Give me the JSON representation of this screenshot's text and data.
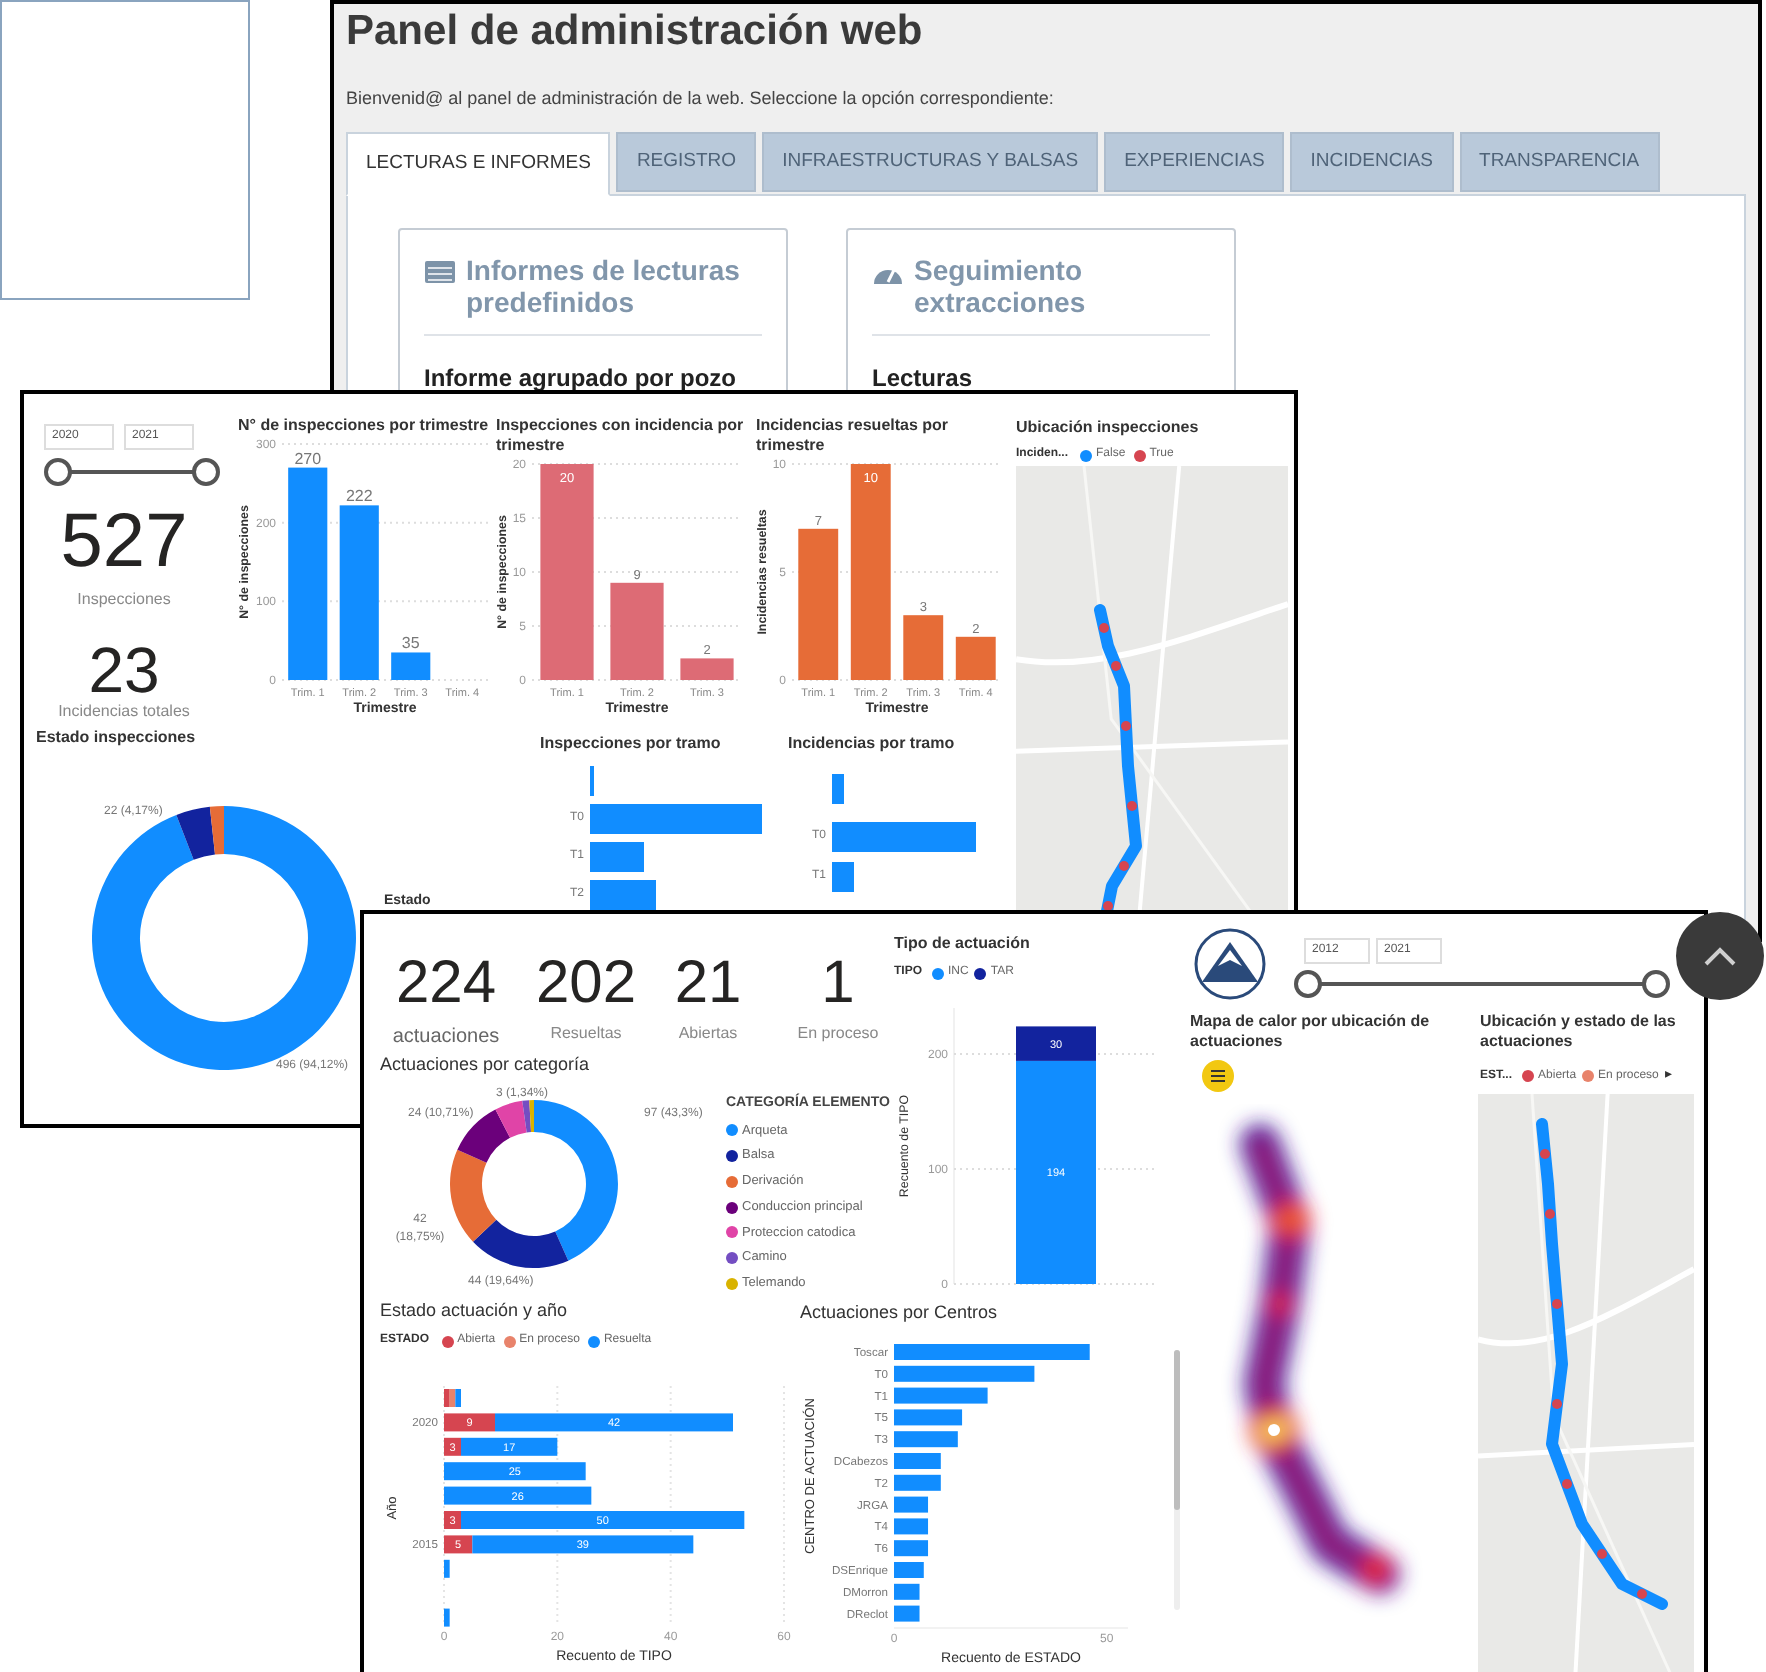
{
  "admin_panel": {
    "title": "Panel de administración web",
    "subtitle": "Bienvenid@ al panel de administración de la web. Seleccione la opción correspondiente:",
    "tabs": [
      {
        "label": "LECTURAS E INFORMES",
        "selected": true
      },
      {
        "label": "REGISTRO",
        "selected": false
      },
      {
        "label": "INFRAESTRUCTURAS Y BALSAS",
        "selected": false
      },
      {
        "label": "EXPERIENCIAS",
        "selected": false
      },
      {
        "label": "INCIDENCIAS",
        "selected": false
      },
      {
        "label": "TRANSPARENCIA",
        "selected": false
      }
    ],
    "cards": [
      {
        "kind": "table",
        "title": "Informes de lecturas predefinidos",
        "items": [
          "Informe agrupado por pozo"
        ]
      },
      {
        "kind": "gauge",
        "title": "Seguimiento extracciones",
        "items": [
          "Lecturas"
        ]
      }
    ]
  },
  "inspections_report": {
    "year_from": "2020",
    "year_to": "2021",
    "year_slider": {
      "thumbs": [
        {
          "level": 0
        },
        {
          "level": 1
        }
      ]
    },
    "kpis": [
      {
        "value": "527",
        "label": "Inspecciones"
      },
      {
        "value": "23",
        "label": "Incidencias totales"
      }
    ],
    "quarter_charts": [
      {
        "chart_data": {
          "type": "bar",
          "title": "N° de inspecciones por trimestre",
          "xlabel": "Trimestre",
          "ylabel": "N° de inspecciones",
          "categories": [
            "Trim. 1",
            "Trim. 2",
            "Trim. 3",
            "Trim. 4"
          ],
          "values": [
            270,
            222,
            35,
            null
          ],
          "ylim": [
            0,
            300
          ],
          "yticks": [
            0,
            100,
            200,
            300
          ],
          "grid": true,
          "data_labels": true
        }
      },
      {
        "chart_data": {
          "type": "bar",
          "title": "Inspecciones con incidencia por trimestre",
          "xlabel": "Trimestre",
          "ylabel": "N° de inspecciones",
          "categories": [
            "Trim. 1",
            "Trim. 2",
            "Trim. 3"
          ],
          "values": [
            20,
            9,
            2
          ],
          "ylim": [
            0,
            20
          ],
          "yticks": [
            0,
            5,
            10,
            15,
            20
          ],
          "grid": true,
          "data_labels": true
        }
      },
      {
        "chart_data": {
          "type": "bar",
          "title": "Incidencias resueltas por trimestre",
          "xlabel": "Trimestre",
          "ylabel": "Incidencias resueltas",
          "categories": [
            "Trim. 1",
            "Trim. 2",
            "Trim. 3",
            "Trim. 4"
          ],
          "values": [
            7,
            10,
            3,
            2
          ],
          "ylim": [
            0,
            10
          ],
          "yticks": [
            0,
            5,
            10
          ],
          "grid": true,
          "data_labels": true
        }
      }
    ],
    "status_chart": {
      "legend_title": "Estado",
      "chart_data": {
        "type": "donut",
        "title": "Estado inspecciones",
        "values": [
          94.12,
          4.17,
          1.71
        ],
        "value_labels": [
          "496 (94,12%)",
          "22 (4,17%)",
          null
        ]
      }
    },
    "section_charts": [
      {
        "title": "Inspecciones por tramo",
        "rows": [
          "T0",
          "T1",
          "T2"
        ]
      },
      {
        "title": "Incidencias por tramo",
        "rows": [
          "T0",
          "T1"
        ]
      }
    ],
    "map": {
      "title": "Ubicación inspecciones",
      "legend_title": "Inciden...",
      "legend": [
        {
          "label": "False",
          "color": "#118dff"
        },
        {
          "label": "True",
          "color": "#d64550"
        }
      ]
    }
  },
  "actions_report": {
    "kpis": [
      {
        "value": "224",
        "label": "actuaciones"
      },
      {
        "value": "202",
        "label": "Resueltas"
      },
      {
        "value": "21",
        "label": "Abiertas"
      },
      {
        "value": "1",
        "label": "En proceso"
      }
    ],
    "category_chart": {
      "legend_title": "CATEGORÍA ELEMENTO",
      "legend": [
        {
          "label": "Arqueta",
          "color": "#118dff"
        },
        {
          "label": "Balsa",
          "color": "#12239e"
        },
        {
          "label": "Derivación",
          "color": "#e66c37"
        },
        {
          "label": "Conduccion principal",
          "color": "#6b007b"
        },
        {
          "label": "Proteccion catodica",
          "color": "#e044a7"
        },
        {
          "label": "Camino",
          "color": "#744ec2"
        },
        {
          "label": "Telemando",
          "color": "#d9b300"
        }
      ],
      "chart_data": {
        "type": "donut",
        "title": "Actuaciones por categoría",
        "values": [
          43.3,
          19.64,
          18.75,
          10.71,
          5.36,
          1.34,
          0.9
        ],
        "value_labels": [
          "97 (43,3%)",
          "44 (19,64%)",
          "42 (18,75%)",
          "24 (10,71%)",
          null,
          "3 (1,34%)",
          null
        ]
      }
    },
    "type_chart": {
      "legend_title": "TIPO",
      "chart_data": {
        "type": "bar",
        "title": "Tipo de actuación",
        "ylabel": "Recuento de TIPO",
        "stacked": true,
        "ylim": [
          0,
          240
        ],
        "yticks": [
          0,
          100,
          200
        ],
        "grid": true,
        "data_labels": true,
        "series": [
          {
            "name": "INC",
            "color": "#118dff",
            "values": [
              194
            ]
          },
          {
            "name": "TAR",
            "color": "#12239e",
            "values": [
              30
            ]
          }
        ]
      }
    },
    "year_chart": {
      "legend_title": "ESTADO",
      "chart_data": {
        "type": "bar",
        "orientation": "horizontal",
        "stacked": true,
        "title": "Estado actuación y año",
        "xlabel": "Recuento de TIPO",
        "ylabel": "Año",
        "categories": [
          null,
          "2020",
          null,
          null,
          null,
          null,
          "2015",
          null,
          null,
          null
        ],
        "xlim": [
          0,
          60
        ],
        "xticks": [
          0,
          20,
          40,
          60
        ],
        "grid": true,
        "series": [
          {
            "name": "Abierta",
            "color": "#d64550",
            "values": [
              1,
              9,
              3,
              0,
              0,
              3,
              5,
              0,
              null,
              0
            ],
            "value_labels": [
              null,
              "9",
              "3",
              null,
              null,
              "3",
              "5",
              null,
              null,
              null
            ]
          },
          {
            "name": "En proceso",
            "color": "#e8836b",
            "values": [
              1,
              0,
              0,
              0,
              0,
              0,
              0,
              0,
              null,
              0
            ]
          },
          {
            "name": "Resuelta",
            "color": "#118dff",
            "values": [
              1,
              42,
              17,
              25,
              26,
              50,
              39,
              1,
              null,
              1
            ],
            "value_labels": [
              null,
              "42",
              "17",
              "25",
              "26",
              "50",
              "39",
              null,
              null,
              null
            ]
          }
        ]
      }
    },
    "centre_chart": {
      "chart_data": {
        "type": "bar",
        "orientation": "horizontal",
        "title": "Actuaciones por Centros",
        "xlabel": "Recuento de ESTADO",
        "ylabel": "CENTRO DE ACTUACIÓN",
        "categories": [
          "Toscar",
          "T0",
          "T1",
          "T5",
          "T3",
          "DCabezos",
          "T2",
          "JRGA",
          "T4",
          "T6",
          "DSEnrique",
          "DMorron",
          "DReclot"
        ],
        "values": [
          46,
          33,
          22,
          16,
          15,
          11,
          11,
          8,
          8,
          8,
          7,
          6,
          6
        ],
        "xlim": [
          0,
          55
        ],
        "xticks": [
          0,
          50
        ]
      }
    },
    "year_from": "2012",
    "year_to": "2021",
    "year_slider": {
      "thumbs": [
        {
          "level": 0
        },
        {
          "level": 1
        }
      ]
    },
    "heatmap": {
      "title": "Mapa de calor por ubicación de actuaciones"
    },
    "map": {
      "title": "Ubicación y estado de las actuaciones",
      "legend_title": "EST...",
      "legend": [
        {
          "label": "Abierta",
          "color": "#d64550"
        },
        {
          "label": "En proceso",
          "color": "#e8836b"
        }
      ],
      "more": "▸"
    }
  }
}
